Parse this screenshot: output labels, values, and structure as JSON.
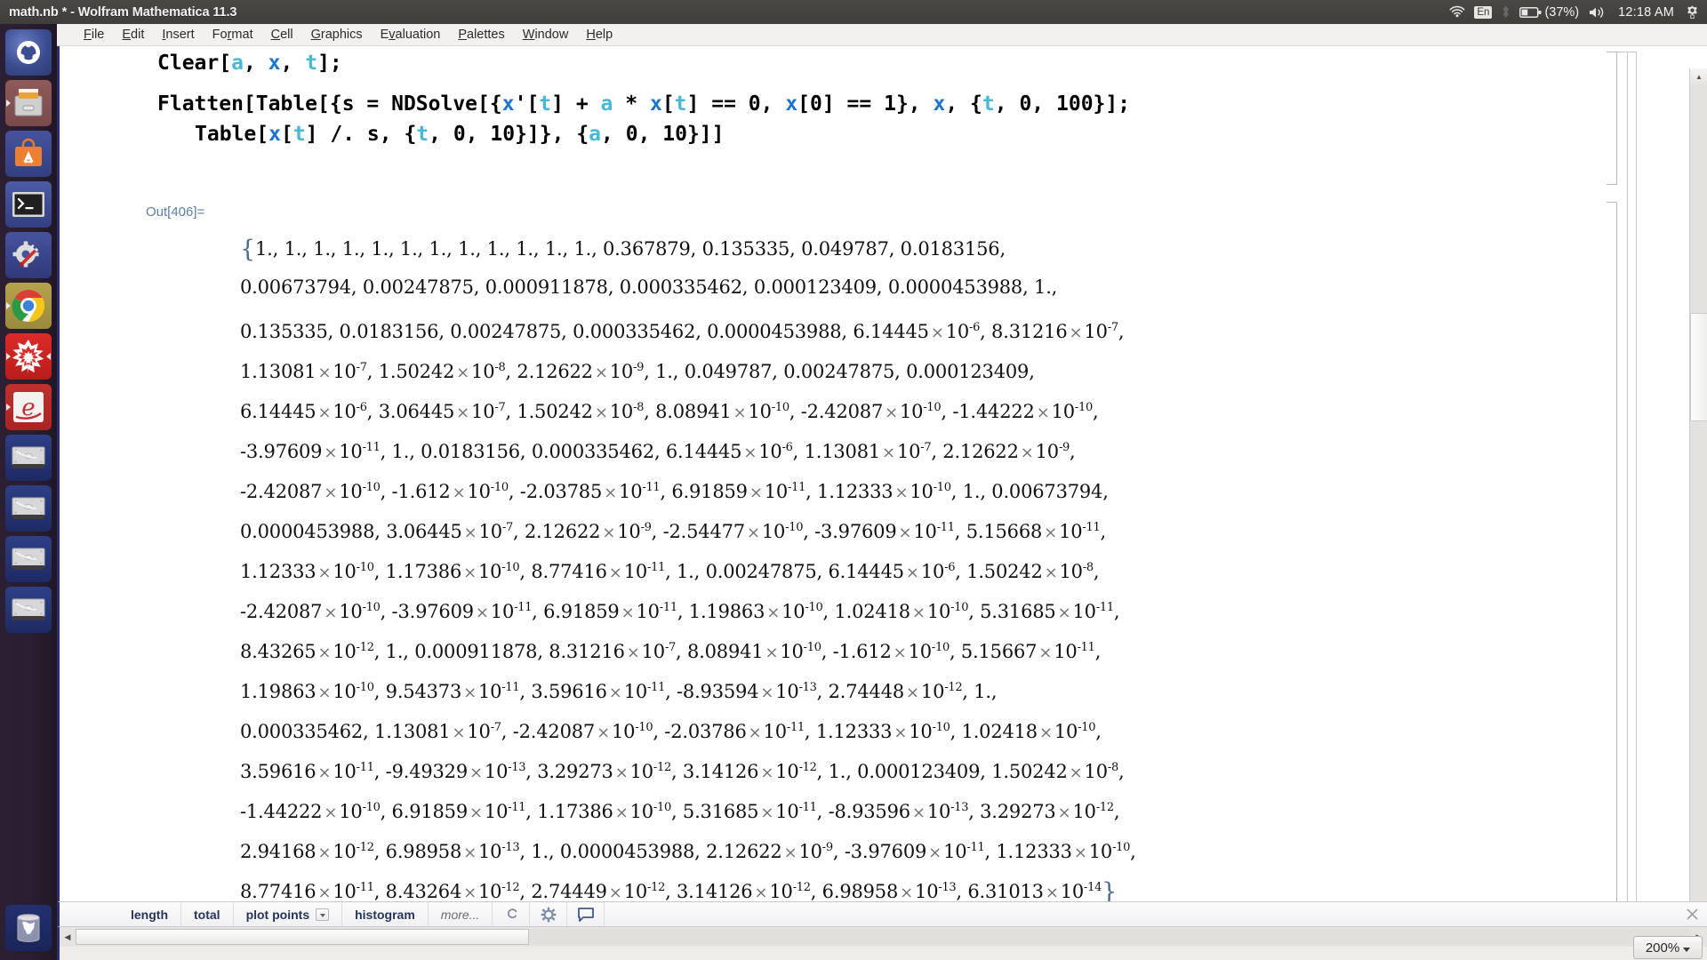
{
  "window": {
    "title": "math.nb * - Wolfram Mathematica 11.3"
  },
  "tray": {
    "wifi_icon": "wifi-icon",
    "keyboard_layout": "En",
    "bluetooth_icon": "bluetooth-icon",
    "battery_icon": "battery-icon",
    "battery_percent": "(37%)",
    "volume_icon": "volume-icon",
    "clock": "12:18 AM",
    "session_icon": "gear-icon"
  },
  "launcher": {
    "items": [
      {
        "name": "ubuntu-dash",
        "label": "Ubuntu Dash",
        "pip_left": false,
        "pip_right": false
      },
      {
        "name": "files",
        "label": "Files",
        "pip_left": true,
        "pip_right": false
      },
      {
        "name": "software-center",
        "label": "Ubuntu Software",
        "pip_left": false,
        "pip_right": false
      },
      {
        "name": "terminal",
        "label": "Terminal",
        "pip_left": false,
        "pip_right": false
      },
      {
        "name": "system-settings",
        "label": "System Settings",
        "pip_left": false,
        "pip_right": false
      },
      {
        "name": "google-chrome",
        "label": "Google Chrome",
        "pip_left": true,
        "pip_right": false
      },
      {
        "name": "wolfram-mathematica",
        "label": "Wolfram Mathematica",
        "pip_left": true,
        "pip_right": true
      },
      {
        "name": "wolfram-reference",
        "label": "Wolfram Documentation",
        "pip_left": true,
        "pip_right": false
      },
      {
        "name": "disk-volume-1",
        "label": "Disk Volume",
        "pip_left": false,
        "pip_right": false
      },
      {
        "name": "disk-volume-2",
        "label": "Disk Volume",
        "pip_left": false,
        "pip_right": false
      },
      {
        "name": "disk-volume-3",
        "label": "Disk Volume",
        "pip_left": false,
        "pip_right": false
      },
      {
        "name": "disk-volume-4",
        "label": "Disk Volume",
        "pip_left": false,
        "pip_right": false
      },
      {
        "name": "trash",
        "label": "Trash",
        "pip_left": false,
        "pip_right": false
      }
    ]
  },
  "menubar": {
    "items": [
      {
        "mnemonic": "F",
        "rest": "ile"
      },
      {
        "mnemonic": "E",
        "rest": "dit"
      },
      {
        "mnemonic": "I",
        "rest": "nsert"
      },
      {
        "mnemonic": "F",
        "rest": "ormat",
        "pre": "",
        "mid": true
      },
      {
        "mnemonic": "C",
        "rest": "ell"
      },
      {
        "mnemonic": "G",
        "rest": "raphics"
      },
      {
        "mnemonic": "E",
        "rest": "valuation"
      },
      {
        "mnemonic": "P",
        "rest": "alettes"
      },
      {
        "mnemonic": "W",
        "rest": "indow"
      },
      {
        "mnemonic": "H",
        "rest": "elp"
      }
    ],
    "labels": [
      "File",
      "Edit",
      "Insert",
      "Format",
      "Cell",
      "Graphics",
      "Evaluation",
      "Palettes",
      "Window",
      "Help"
    ]
  },
  "notebook": {
    "input_cell": {
      "line1": "Clear[a, x, t];",
      "line2": "Flatten[Table[{s = NDSolve[{x'[t] + a * x[t] == 0, x[0] == 1}, x, {t, 0, 100}];",
      "line3": "Table[x[t] /. s, {t, 0, 10}]}, {a, 0, 10}]]"
    },
    "output_label": "Out[406]=",
    "output_rows": [
      "{1., 1., 1., 1., 1., 1., 1., 1., 1., 1., 1., 1., 0.367879, 0.135335, 0.049787, 0.0183156,",
      "0.00673794, 0.00247875, 0.000911878, 0.000335462, 0.000123409, 0.0000453988, 1.,",
      "0.135335, 0.0183156, 0.00247875, 0.000335462, 0.0000453988, 6.14445×10^-6, 8.31216×10^-7,",
      "1.13081×10^-7, 1.50242×10^-8, 2.12622×10^-9, 1., 0.049787, 0.00247875, 0.000123409,",
      "6.14445×10^-6, 3.06445×10^-7, 1.50242×10^-8, 8.08941×10^-10, -2.42087×10^-10, -1.44222×10^-10,",
      "-3.97609×10^-11, 1., 0.0183156, 0.000335462, 6.14445×10^-6, 1.13081×10^-7, 2.12622×10^-9,",
      "-2.42087×10^-10, -1.612×10^-10, -2.03785×10^-11, 6.91859×10^-11, 1.12333×10^-10, 1., 0.00673794,",
      "0.0000453988, 3.06445×10^-7, 2.12622×10^-9, -2.54477×10^-10, -3.97609×10^-11, 5.15668×10^-11,",
      "1.12333×10^-10, 1.17386×10^-10, 8.77416×10^-11, 1., 0.00247875, 6.14445×10^-6, 1.50242×10^-8,",
      "-2.42087×10^-10, -3.97609×10^-11, 6.91859×10^-11, 1.19863×10^-10, 1.02418×10^-10, 5.31685×10^-11,",
      "8.43265×10^-12, 1., 0.000911878, 8.31216×10^-7, 8.08941×10^-10, -1.612×10^-10, 5.15667×10^-11,",
      "1.19863×10^-10, 9.54373×10^-11, 3.59616×10^-11, -8.93594×10^-13, 2.74448×10^-12, 1.,",
      "0.000335462, 1.13081×10^-7, -2.42087×10^-10, -2.03786×10^-11, 1.12333×10^-10, 1.02418×10^-10,",
      "3.59616×10^-11, -9.49329×10^-13, 3.29273×10^-12, 3.14126×10^-12, 1., 0.000123409, 1.50242×10^-8,",
      "-1.44222×10^-10, 6.91859×10^-11, 1.17386×10^-10, 5.31685×10^-11, -8.93596×10^-13, 3.29273×10^-12,",
      "2.94168×10^-12, 6.98958×10^-13, 1., 0.0000453988, 2.12622×10^-9, -3.97609×10^-11, 1.12333×10^-10,",
      "8.77416×10^-11, 8.43264×10^-12, 2.74449×10^-12, 3.14126×10^-12, 6.98958×10^-13, 6.31013×10^-14}"
    ]
  },
  "suggestion_bar": {
    "buttons": [
      "length",
      "total",
      "plot points",
      "histogram",
      "more..."
    ],
    "icons": [
      "wolfram-alpha-icon",
      "gear-icon",
      "comment-icon"
    ],
    "close_icon": "close-icon"
  },
  "status": {
    "zoom_level": "200%"
  }
}
